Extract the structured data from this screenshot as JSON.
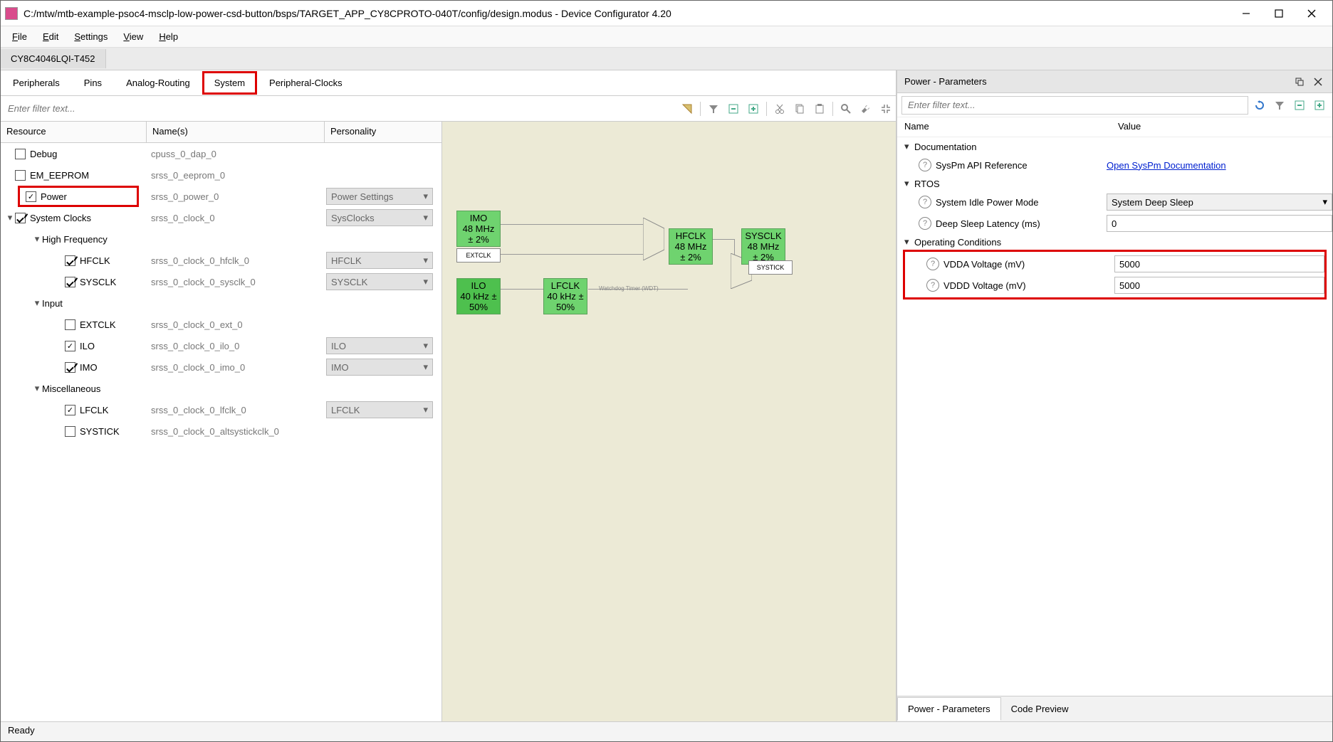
{
  "titlebar": {
    "title": "C:/mtw/mtb-example-psoc4-msclp-low-power-csd-button/bsps/TARGET_APP_CY8CPROTO-040T/config/design.modus - Device Configurator 4.20"
  },
  "menubar": {
    "file": "File",
    "edit": "Edit",
    "settings": "Settings",
    "view": "View",
    "help": "Help"
  },
  "device": "CY8C4046LQI-T452",
  "tabs": {
    "peripherals": "Peripherals",
    "pins": "Pins",
    "analog": "Analog-Routing",
    "system": "System",
    "pclocks": "Peripheral-Clocks"
  },
  "filter_placeholder": "Enter filter text...",
  "treehdr": {
    "resource": "Resource",
    "names": "Name(s)",
    "personality": "Personality"
  },
  "tree": {
    "debug": {
      "label": "Debug",
      "name": "cpuss_0_dap_0"
    },
    "eeprom": {
      "label": "EM_EEPROM",
      "name": "srss_0_eeprom_0"
    },
    "power": {
      "label": "Power",
      "name": "srss_0_power_0",
      "personality": "Power Settings"
    },
    "sysclocks": {
      "label": "System Clocks",
      "name": "srss_0_clock_0",
      "personality": "SysClocks"
    },
    "highfreq": "High Frequency",
    "hfclk": {
      "label": "HFCLK",
      "name": "srss_0_clock_0_hfclk_0",
      "personality": "HFCLK"
    },
    "sysclk": {
      "label": "SYSCLK",
      "name": "srss_0_clock_0_sysclk_0",
      "personality": "SYSCLK"
    },
    "input": "Input",
    "extclk": {
      "label": "EXTCLK",
      "name": "srss_0_clock_0_ext_0"
    },
    "ilo": {
      "label": "ILO",
      "name": "srss_0_clock_0_ilo_0",
      "personality": "ILO"
    },
    "imo": {
      "label": "IMO",
      "name": "srss_0_clock_0_imo_0",
      "personality": "IMO"
    },
    "misc": "Miscellaneous",
    "lfclk": {
      "label": "LFCLK",
      "name": "srss_0_clock_0_lfclk_0",
      "personality": "LFCLK"
    },
    "systick": {
      "label": "SYSTICK",
      "name": "srss_0_clock_0_altsystickclk_0"
    }
  },
  "canvas": {
    "imo": "IMO",
    "imo_sub": "48 MHz ± 2%",
    "extclk": "EXTCLK",
    "hfclk": "HFCLK",
    "hfclk_sub": "48 MHz ± 2%",
    "sysclk": "SYSCLK",
    "sysclk_sub": "48 MHz ± 2%",
    "systick": "SYSTICK",
    "ilo": "ILO",
    "ilo_sub": "40 kHz ± 50%",
    "lfclk": "LFCLK",
    "lfclk_sub": "40 kHz ± 50%",
    "wdt": "Watchdog Timer (WDT)"
  },
  "rtitle": "Power - Parameters",
  "rfilter_placeholder": "Enter filter text...",
  "paramhdr": {
    "name": "Name",
    "value": "Value"
  },
  "params": {
    "documentation": "Documentation",
    "syspm_api": {
      "label": "SysPm API Reference",
      "value": "Open SysPm Documentation"
    },
    "rtos": "RTOS",
    "idle_mode": {
      "label": "System Idle Power Mode",
      "value": "System Deep Sleep"
    },
    "deep_sleep": {
      "label": "Deep Sleep Latency (ms)",
      "value": "0"
    },
    "opcond": "Operating Conditions",
    "vdda": {
      "label": "VDDA Voltage (mV)",
      "value": "5000"
    },
    "vddd": {
      "label": "VDDD Voltage (mV)",
      "value": "5000"
    }
  },
  "rtabs": {
    "params": "Power - Parameters",
    "code": "Code Preview"
  },
  "status": "Ready"
}
